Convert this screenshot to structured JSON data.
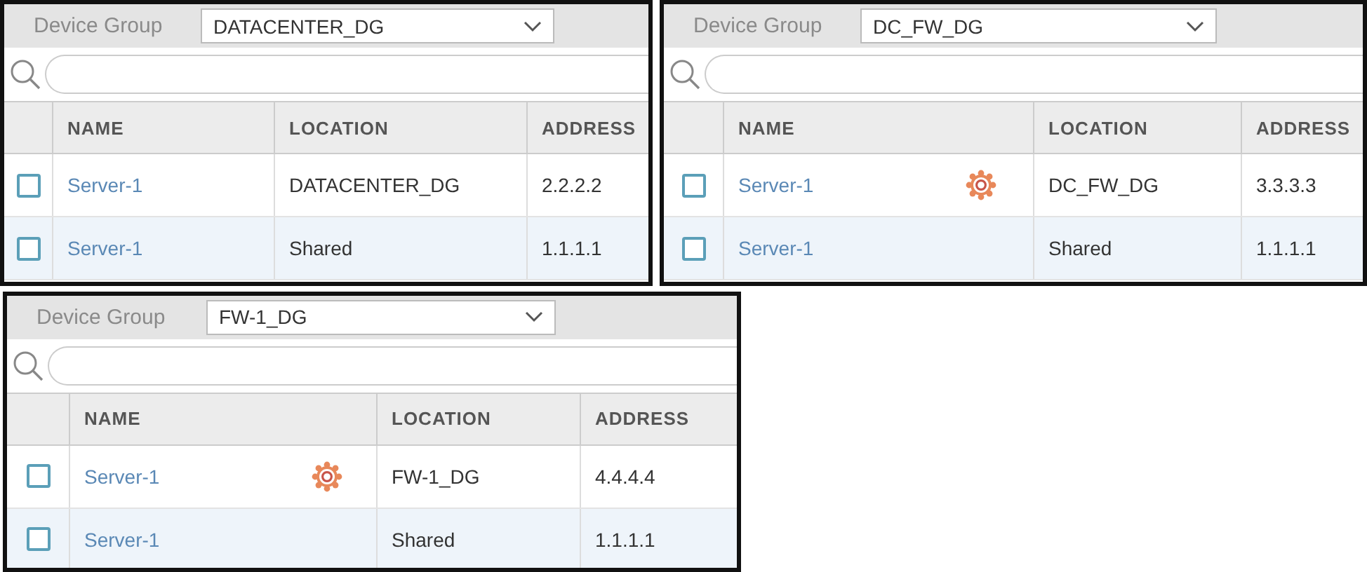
{
  "panels": [
    {
      "device_group_label": "Device Group",
      "device_group": "DATACENTER_DG",
      "columns": [
        "NAME",
        "LOCATION",
        "ADDRESS"
      ],
      "rows": [
        {
          "checked": false,
          "name": "Server-1",
          "overridden": false,
          "location": "DATACENTER_DG",
          "address": "2.2.2.2"
        },
        {
          "checked": false,
          "name": "Server-1",
          "overridden": false,
          "location": "Shared",
          "address": "1.1.1.1"
        }
      ]
    },
    {
      "device_group_label": "Device Group",
      "device_group": "DC_FW_DG",
      "columns": [
        "NAME",
        "LOCATION",
        "ADDRESS"
      ],
      "rows": [
        {
          "checked": false,
          "name": "Server-1",
          "overridden": true,
          "location": "DC_FW_DG",
          "address": "3.3.3.3"
        },
        {
          "checked": false,
          "name": "Server-1",
          "overridden": false,
          "location": "Shared",
          "address": "1.1.1.1"
        }
      ]
    },
    {
      "device_group_label": "Device Group",
      "device_group": "FW-1_DG",
      "columns": [
        "NAME",
        "LOCATION",
        "ADDRESS"
      ],
      "rows": [
        {
          "checked": false,
          "name": "Server-1",
          "overridden": true,
          "location": "FW-1_DG",
          "address": "4.4.4.4"
        },
        {
          "checked": false,
          "name": "Server-1",
          "overridden": false,
          "location": "Shared",
          "address": "1.1.1.1"
        }
      ]
    }
  ]
}
